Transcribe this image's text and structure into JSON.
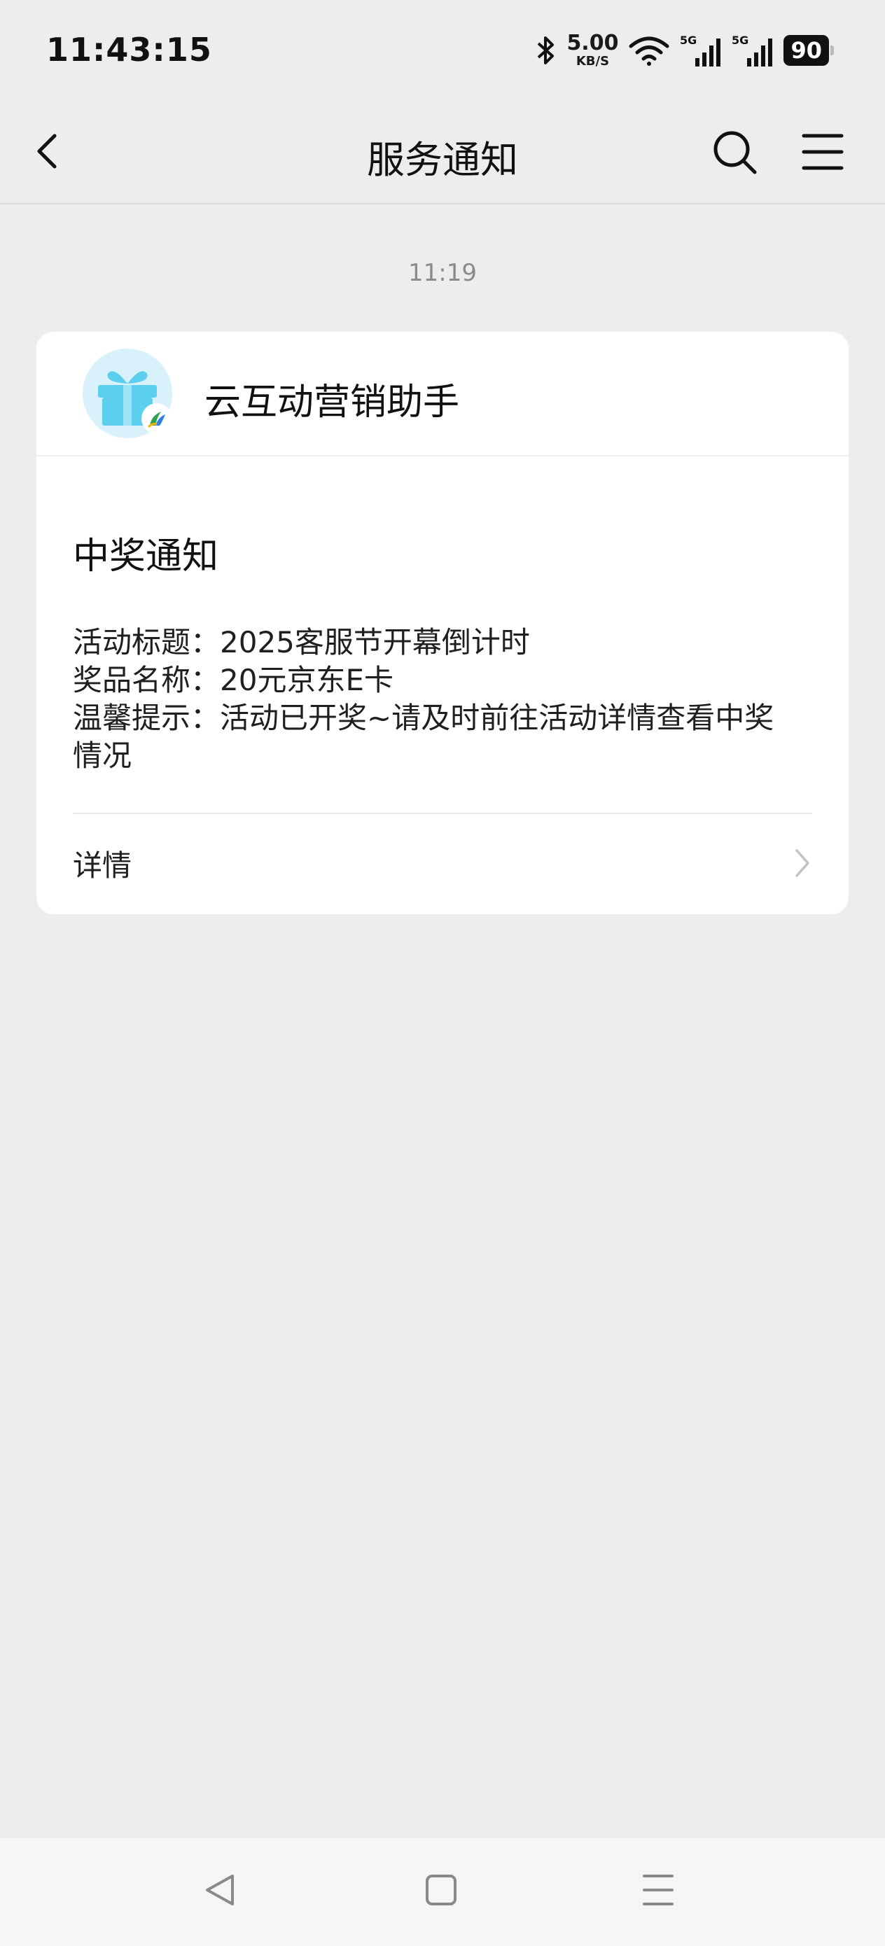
{
  "status_bar": {
    "time": "11:43:15",
    "net_speed_value": "5.00",
    "net_speed_unit": "KB/S",
    "network_1": "5G",
    "network_2": "5G",
    "battery": "90"
  },
  "nav": {
    "title": "服务通知",
    "back_icon": "chevron-left-icon",
    "search_icon": "search-icon",
    "menu_icon": "menu-icon"
  },
  "message": {
    "time": "11:19",
    "sender": "云互动营销助手",
    "avatar_icon": "gift-icon",
    "title": "中奖通知",
    "fields": [
      {
        "key": "活动标题：",
        "value": "2025客服节开幕倒计时"
      },
      {
        "key": "奖品名称：",
        "value": "20元京东E卡"
      },
      {
        "key": "温馨提示：",
        "value": "活动已开奖~请及时前往活动详情查看中奖",
        "value_cont": "情况"
      }
    ],
    "detail_label": "详情"
  },
  "bottom_nav": {
    "back_icon": "triangle-back-icon",
    "home_icon": "square-home-icon",
    "recents_icon": "menu-lines-icon"
  },
  "colors": {
    "background": "#ededed",
    "card": "#ffffff",
    "avatar_bg": "#d9f1fb",
    "gift": "#5ccfee"
  }
}
